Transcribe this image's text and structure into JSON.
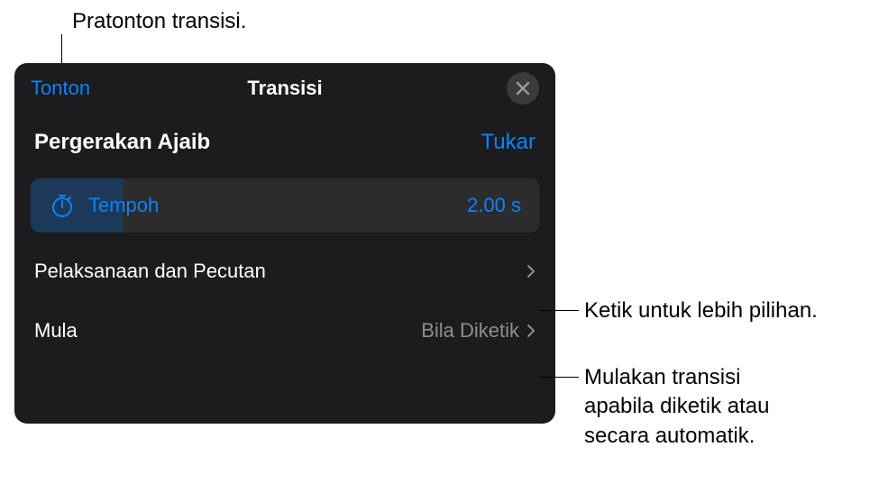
{
  "callouts": {
    "preview": "Pratonton transisi.",
    "more_options": "Ketik untuk lebih pilihan.",
    "start_info_line1": "Mulakan transisi",
    "start_info_line2": "apabila diketik atau",
    "start_info_line3": "secara automatik."
  },
  "header": {
    "watch": "Tonton",
    "title": "Transisi"
  },
  "transition": {
    "name": "Pergerakan Ajaib",
    "change": "Tukar"
  },
  "duration": {
    "label": "Tempoh",
    "value": "2.00 s"
  },
  "delivery": {
    "label": "Pelaksanaan dan Pecutan"
  },
  "start": {
    "label": "Mula",
    "value": "Bila Diketik"
  }
}
